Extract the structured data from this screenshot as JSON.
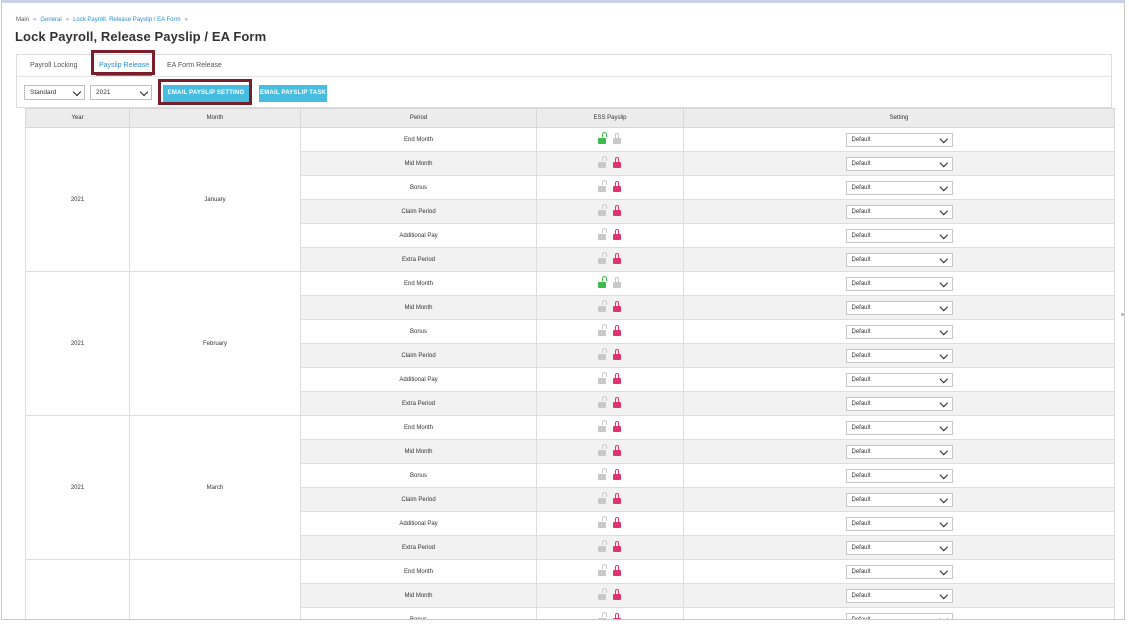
{
  "breadcrumb": {
    "home": "Main",
    "section": "General",
    "current": "Lock Payroll, Release Payslip / EA Form"
  },
  "page_title": "Lock Payroll, Release Payslip / EA Form",
  "tabs": [
    {
      "label": "Payroll Locking",
      "active": false
    },
    {
      "label": "Payslip Release",
      "active": true
    },
    {
      "label": "EA Form Release",
      "active": false
    }
  ],
  "toolbar": {
    "type_select": "Standard",
    "year_select": "2021",
    "email_setting_label": "EMAIL PAYSLIP SETTING",
    "email_task_label": "EMAIL PAYSLIP TASK"
  },
  "table": {
    "headers": {
      "year": "Year",
      "month": "Month",
      "period": "Period",
      "ess": "ESS Payslip",
      "setting": "Setting"
    },
    "groups": [
      {
        "year": "2021",
        "month": "January",
        "rows": [
          {
            "period": "End Month",
            "unlocked_active": true,
            "setting": "Default"
          },
          {
            "period": "Mid Month",
            "unlocked_active": false,
            "setting": "Default"
          },
          {
            "period": "Bonus",
            "unlocked_active": false,
            "setting": "Default"
          },
          {
            "period": "Claim Period",
            "unlocked_active": false,
            "setting": "Default"
          },
          {
            "period": "Additional Pay",
            "unlocked_active": false,
            "setting": "Default"
          },
          {
            "period": "Extra Period",
            "unlocked_active": false,
            "setting": "Default"
          }
        ]
      },
      {
        "year": "2021",
        "month": "February",
        "rows": [
          {
            "period": "End Month",
            "unlocked_active": true,
            "setting": "Default"
          },
          {
            "period": "Mid Month",
            "unlocked_active": false,
            "setting": "Default"
          },
          {
            "period": "Bonus",
            "unlocked_active": false,
            "setting": "Default"
          },
          {
            "period": "Claim Period",
            "unlocked_active": false,
            "setting": "Default"
          },
          {
            "period": "Additional Pay",
            "unlocked_active": false,
            "setting": "Default"
          },
          {
            "period": "Extra Period",
            "unlocked_active": false,
            "setting": "Default"
          }
        ]
      },
      {
        "year": "2021",
        "month": "March",
        "rows": [
          {
            "period": "End Month",
            "unlocked_active": false,
            "setting": "Default"
          },
          {
            "period": "Mid Month",
            "unlocked_active": false,
            "setting": "Default"
          },
          {
            "period": "Bonus",
            "unlocked_active": false,
            "setting": "Default"
          },
          {
            "period": "Claim Period",
            "unlocked_active": false,
            "setting": "Default"
          },
          {
            "period": "Additional Pay",
            "unlocked_active": false,
            "setting": "Default"
          },
          {
            "period": "Extra Period",
            "unlocked_active": false,
            "setting": "Default"
          }
        ]
      },
      {
        "year": "",
        "month": "",
        "rows": [
          {
            "period": "End Month",
            "unlocked_active": false,
            "setting": "Default"
          },
          {
            "period": "Mid Month",
            "unlocked_active": false,
            "setting": "Default"
          },
          {
            "period": "Bonus",
            "unlocked_active": false,
            "setting": "Default"
          }
        ]
      }
    ]
  },
  "colors": {
    "accent": "#2c8fcf",
    "button": "#47bde0",
    "highlight": "#7a1e2b",
    "unlocked_active": "#3db84a",
    "locked": "#e0336f",
    "inactive": "#c8c8c8"
  }
}
